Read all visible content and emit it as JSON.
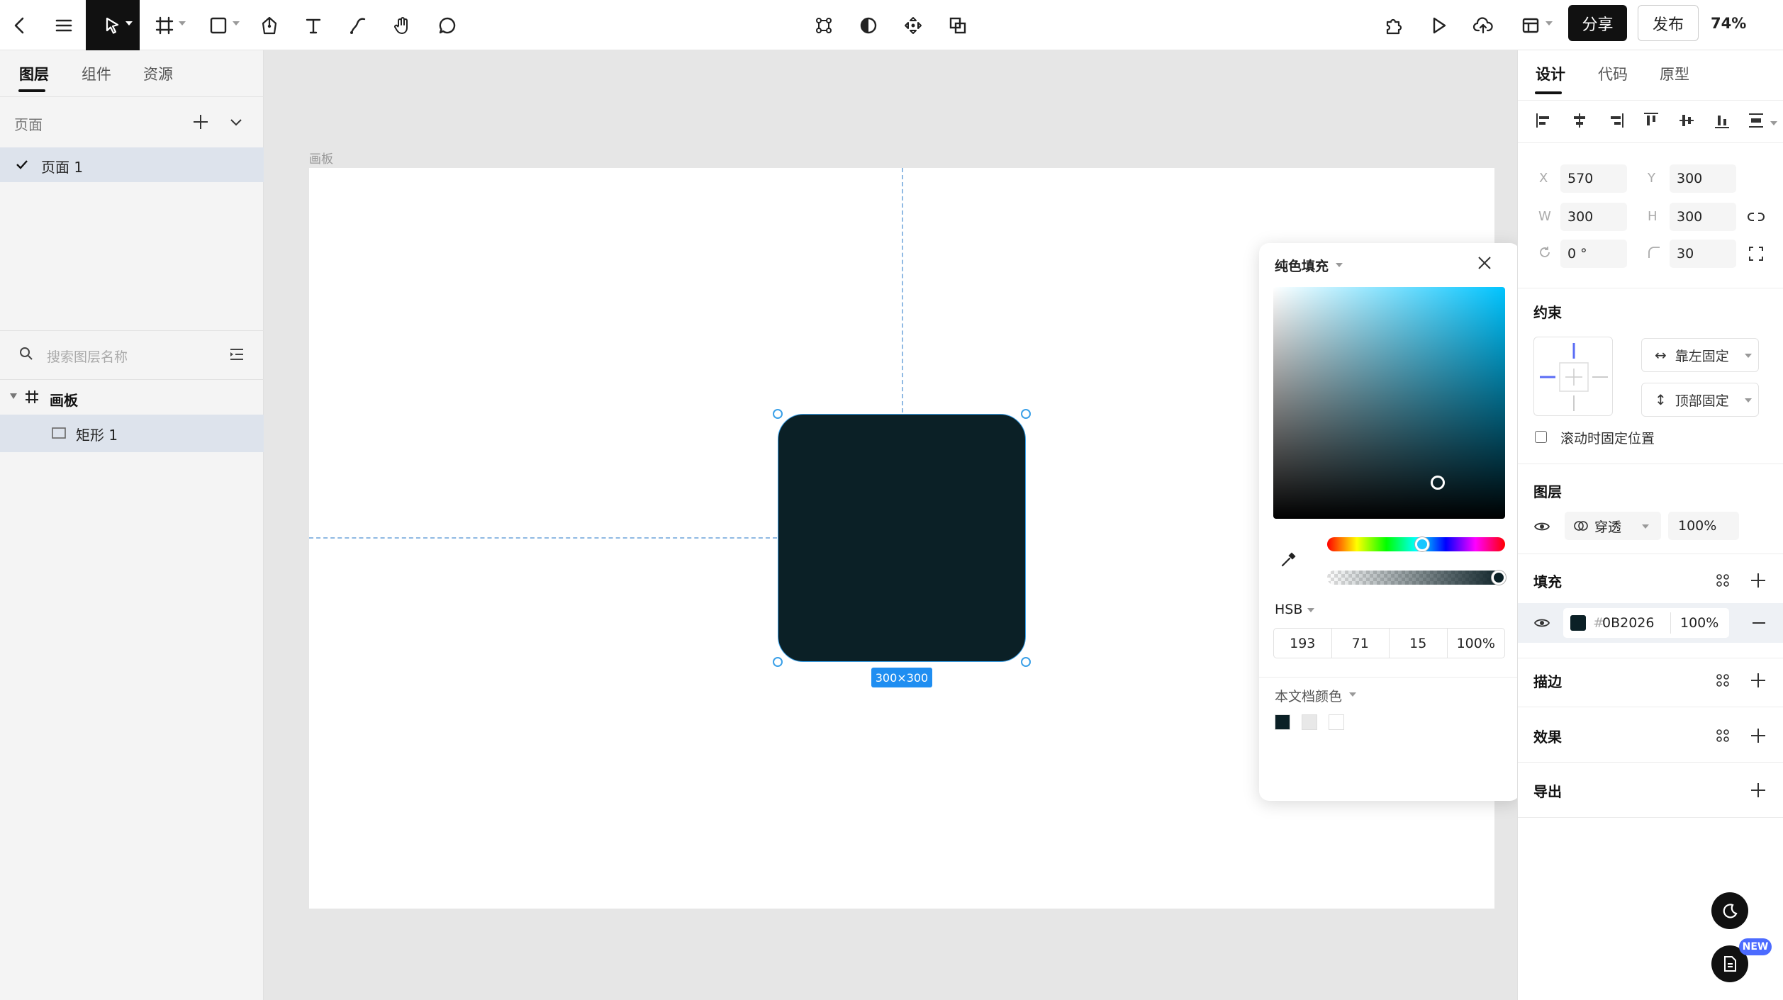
{
  "toolbar": {
    "share_label": "分享",
    "publish_label": "发布",
    "zoom": "74%"
  },
  "left_panel": {
    "tabs": [
      "图层",
      "组件",
      "资源"
    ],
    "pages_label": "页面",
    "pages": [
      "页面 1"
    ],
    "search_placeholder": "搜索图层名称",
    "layers": [
      {
        "name": "画板",
        "type": "frame"
      },
      {
        "name": "矩形 1",
        "type": "rectangle"
      }
    ]
  },
  "canvas": {
    "artboard_label": "画板",
    "selection_size": "300×300",
    "shape_color": "#0B2026"
  },
  "color_picker": {
    "fill_type": "纯色填充",
    "mode": "HSB",
    "h": "193",
    "s": "71",
    "b": "15",
    "alpha": "100%",
    "doc_colors_label": "本文档颜色",
    "doc_colors": [
      "#0B2026",
      "#E8E8E8",
      "#FFFFFF"
    ]
  },
  "right_panel": {
    "tabs": [
      "设计",
      "代码",
      "原型"
    ],
    "x_label": "X",
    "x": "570",
    "y_label": "Y",
    "y": "300",
    "w_label": "W",
    "w": "300",
    "h_label": "H",
    "h": "300",
    "rotation": "0 °",
    "radius": "30",
    "constraints_title": "约束",
    "constraint_h": "靠左固定",
    "constraint_v": "顶部固定",
    "scroll_fixed_label": "滚动时固定位置",
    "layer_title": "图层",
    "blend_mode": "穿透",
    "layer_opacity": "100%",
    "fill_title": "填充",
    "fill_hex": "0B2026",
    "fill_hash": "#",
    "fill_opacity": "100%",
    "stroke_title": "描边",
    "effects_title": "效果",
    "export_title": "导出",
    "new_badge": "NEW"
  }
}
